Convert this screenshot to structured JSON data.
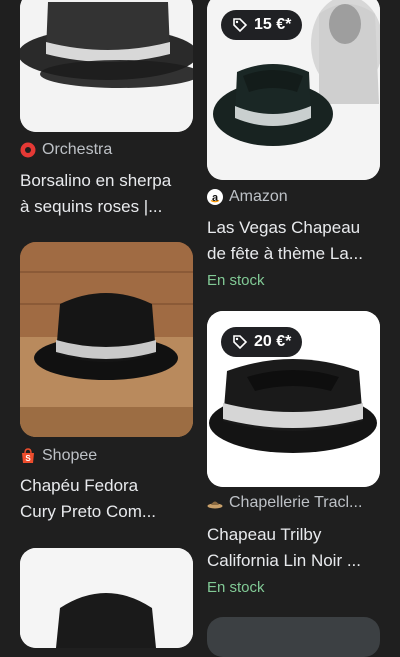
{
  "results": [
    {
      "source": "Orchestra",
      "title_line1": "Borsalino en sherpa",
      "title_line2": "à sequins roses |...",
      "source_icon": "orchestra-icon"
    },
    {
      "source": "Amazon",
      "price": "15 €*",
      "title_line1": "Las Vegas Chapeau",
      "title_line2": "de fête à thème La...",
      "stock": "En stock",
      "source_icon": "amazon-icon"
    },
    {
      "source": "Shopee",
      "title_line1": "Chapéu Fedora",
      "title_line2": "Cury Preto Com...",
      "source_icon": "shopee-icon"
    },
    {
      "source": "Chapellerie Tracl...",
      "price": "20 €*",
      "title_line1": "Chapeau Trilby",
      "title_line2": "California Lin Noir ...",
      "stock": "En stock",
      "source_icon": "hat-logo-icon"
    }
  ],
  "colors": {
    "background": "#1f1f1f",
    "stock": "#81c995",
    "orchestra": "#e53935",
    "shopee": "#ee4d2d"
  }
}
